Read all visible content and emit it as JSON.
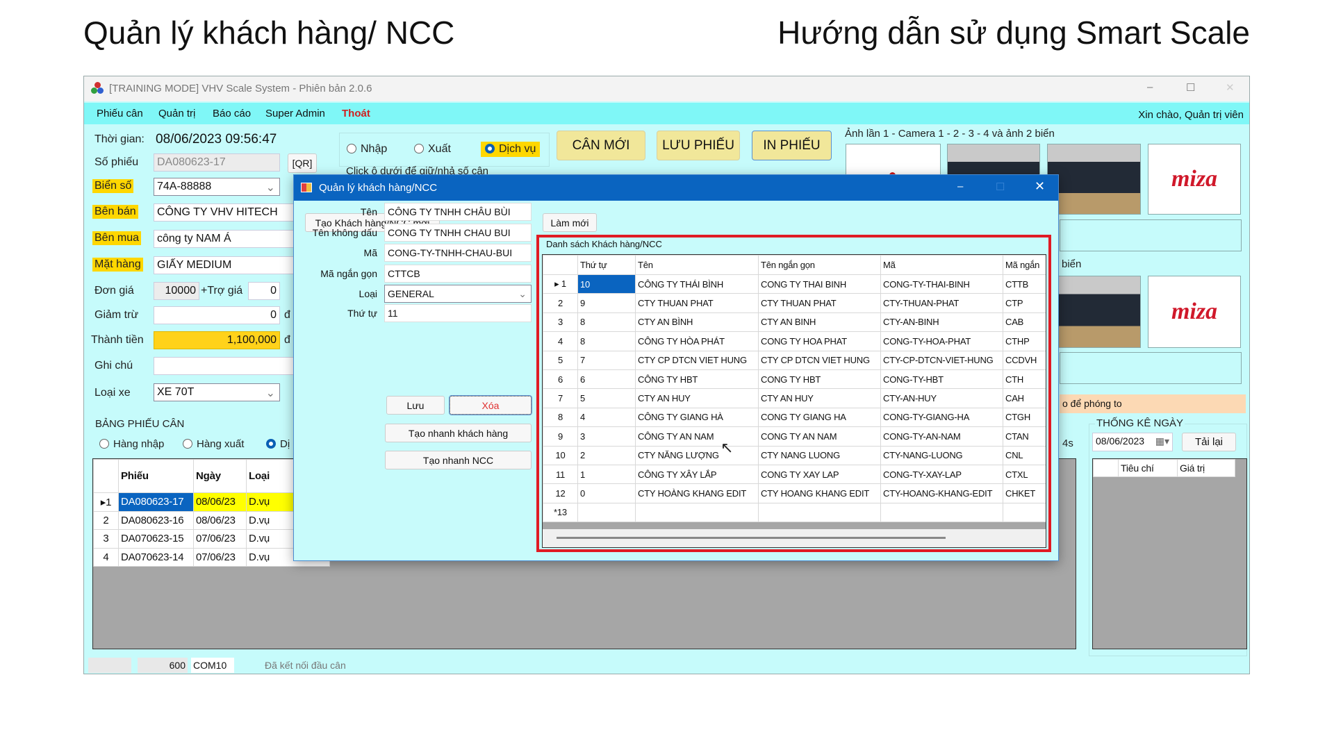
{
  "slide": {
    "title_left": "Quản lý khách hàng/ NCC",
    "title_right": "Hướng dẫn sử dụng Smart Scale"
  },
  "window": {
    "title": "[TRAINING MODE] VHV Scale System - Phiên bản 2.0.6",
    "controls": [
      "–",
      "☐",
      "✕"
    ]
  },
  "menu": {
    "items": [
      "Phiếu cân",
      "Quản trị",
      "Báo cáo",
      "Super Admin",
      "Thoát"
    ],
    "greeting": "Xin chào, Quản trị viên",
    "exit_color": "#d02020"
  },
  "form": {
    "time_label": "Thời gian:",
    "time_value": "08/06/2023 09:56:47",
    "ticket_label": "Số phiếu",
    "ticket_value": "DA080623-17",
    "qr_label": "[QR]",
    "plate_label": "Biển số",
    "plate_value": "74A-88888",
    "seller_label": "Bên bán",
    "seller_value": "CÔNG TY VHV HITECH",
    "buyer_label": "Bên mua",
    "buyer_value": "công ty NAM Á",
    "goods_label": "Mặt hàng",
    "goods_value": "GIẤY MEDIUM",
    "price_label": "Đơn giá",
    "price_value": "10000",
    "subsidy_label": "+Trợ giá",
    "subsidy_value": "0",
    "deduct_label": "Giảm trừ",
    "deduct_value": "0",
    "currency": "đ",
    "total_label": "Thành tiền",
    "total_value": "1,100,000",
    "note_label": "Ghi chú",
    "note_value": "",
    "vehicle_label": "Loại xe",
    "vehicle_value": "XE 70T"
  },
  "mode": {
    "options": [
      "Nhập",
      "Xuất",
      "Dịch vụ"
    ],
    "selected": "Dịch vụ",
    "hint": "Click ô dưới để giữ/nhả số cân"
  },
  "actions": {
    "new": "CÂN MỚI",
    "save": "LƯU PHIẾU",
    "print": "IN PHIẾU"
  },
  "camera": {
    "label": "Ảnh lần 1 - Camera 1 - 2 - 3 - 4 và ảnh 2 biển",
    "label2": "biển",
    "logo": "miza",
    "zoom_hint": "o để phóng to",
    "timer": "4s"
  },
  "tickets": {
    "title": "BẢNG PHIẾU CÂN",
    "filters": [
      "Hàng nhập",
      "Hàng xuất",
      "Dị"
    ],
    "columns": [
      "",
      "Phiếu",
      "Ngày",
      "Loại"
    ],
    "rows": [
      [
        "▸1",
        "DA080623-17",
        "08/06/23",
        "D.vụ"
      ],
      [
        "2",
        "DA080623-16",
        "08/06/23",
        "D.vụ"
      ],
      [
        "3",
        "DA070623-15",
        "07/06/23",
        "D.vụ"
      ],
      [
        "4",
        "DA070623-14",
        "07/06/23",
        "D.vụ"
      ]
    ]
  },
  "stats": {
    "title": "THỐNG KÊ NGÀY",
    "date": "08/06/2023",
    "reload": "Tải lại",
    "columns": [
      "",
      "Tiêu chí",
      "Giá trị"
    ]
  },
  "status": {
    "weight": "600",
    "port": "COM10",
    "message": "Đã kết nối đầu cân"
  },
  "dialog": {
    "title": "Quản lý khách hàng/NCC",
    "create_new": "Tạo Khách hàng/NCC mới",
    "refresh": "Làm mới",
    "fields": [
      {
        "label": "Tên",
        "value": "CÔNG TY TNHH CHÂU BÙI"
      },
      {
        "label": "Tên không dấu",
        "value": "CONG TY TNHH CHAU BUI"
      },
      {
        "label": "Mã",
        "value": "CONG-TY-TNHH-CHAU-BUI"
      },
      {
        "label": "Mã ngắn gọn",
        "value": "CTTCB"
      },
      {
        "label": "Loại",
        "value": "GENERAL"
      },
      {
        "label": "Thứ tự",
        "value": "11"
      }
    ],
    "save": "Lưu",
    "delete": "Xóa",
    "quick_customer": "Tạo nhanh khách hàng",
    "quick_supplier": "Tạo nhanh NCC",
    "list_title": "Danh sách Khách hàng/NCC",
    "columns": [
      "",
      "Thứ tự",
      "Tên",
      "Tên ngắn gọn",
      "Mã",
      "Mã ngắn"
    ],
    "rows": [
      [
        "▸ 1",
        "10",
        "CÔNG TY THÁI BÌNH",
        "CONG TY THAI BINH",
        "CONG-TY-THAI-BINH",
        "CTTB"
      ],
      [
        "2",
        "9",
        "CTY THUAN PHAT",
        "CTY THUAN PHAT",
        "CTY-THUAN-PHAT",
        "CTP"
      ],
      [
        "3",
        "8",
        "CTY AN BÌNH",
        "CTY AN BINH",
        "CTY-AN-BINH",
        "CAB"
      ],
      [
        "4",
        "8",
        "CÔNG TY HÒA PHÁT",
        "CONG TY HOA PHAT",
        "CONG-TY-HOA-PHAT",
        "CTHP"
      ],
      [
        "5",
        "7",
        "CTY CP DTCN VIET HUNG",
        "CTY CP DTCN VIET HUNG",
        "CTY-CP-DTCN-VIET-HUNG",
        "CCDVH"
      ],
      [
        "6",
        "6",
        "CÔNG TY HBT",
        "CONG TY HBT",
        "CONG-TY-HBT",
        "CTH"
      ],
      [
        "7",
        "5",
        "CTY AN HUY",
        "CTY AN HUY",
        "CTY-AN-HUY",
        "CAH"
      ],
      [
        "8",
        "4",
        "CÔNG TY GIANG HÀ",
        "CONG TY GIANG HA",
        "CONG-TY-GIANG-HA",
        "CTGH"
      ],
      [
        "9",
        "3",
        "CÔNG TY AN NAM",
        "CONG TY AN NAM",
        "CONG-TY-AN-NAM",
        "CTAN"
      ],
      [
        "10",
        "2",
        "CTY NĂNG LƯỢNG",
        "CTY NANG LUONG",
        "CTY-NANG-LUONG",
        "CNL"
      ],
      [
        "11",
        "1",
        "CÔNG TY XÂY LẮP",
        "CONG TY XAY LAP",
        "CONG-TY-XAY-LAP",
        "CTXL"
      ],
      [
        "12",
        "0",
        "CTY HOÀNG KHANG EDIT",
        "CTY HOANG KHANG EDIT",
        "CTY-HOANG-KHANG-EDIT",
        "CHKET"
      ],
      [
        "*13",
        "",
        "",
        "",
        "",
        ""
      ]
    ]
  },
  "colors": {
    "accent_blue": "#0a64c0",
    "highlight_red": "#e01b24",
    "yellow": "#ffd700"
  }
}
